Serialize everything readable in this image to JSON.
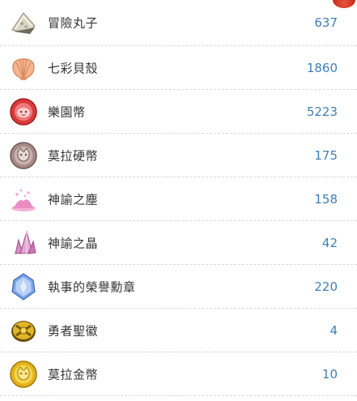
{
  "items": [
    {
      "name": "冒險丸子",
      "value": "637",
      "icon": "dango-icon"
    },
    {
      "name": "七彩貝殼",
      "value": "1860",
      "icon": "shell-icon"
    },
    {
      "name": "樂園幣",
      "value": "5223",
      "icon": "paradise-coin-icon"
    },
    {
      "name": "莫拉硬幣",
      "value": "175",
      "icon": "mora-coin-icon"
    },
    {
      "name": "神諭之塵",
      "value": "158",
      "icon": "oracle-dust-icon"
    },
    {
      "name": "神諭之晶",
      "value": "42",
      "icon": "oracle-crystal-icon"
    },
    {
      "name": "執事的榮譽勳章",
      "value": "220",
      "icon": "butler-medal-icon"
    },
    {
      "name": "勇者聖徽",
      "value": "4",
      "icon": "hero-emblem-icon"
    },
    {
      "name": "莫拉金幣",
      "value": "10",
      "icon": "mora-gold-coin-icon"
    }
  ],
  "colors": {
    "value_text": "#3f7fb6",
    "name_text": "#333333",
    "divider": "#d8d8d8"
  }
}
